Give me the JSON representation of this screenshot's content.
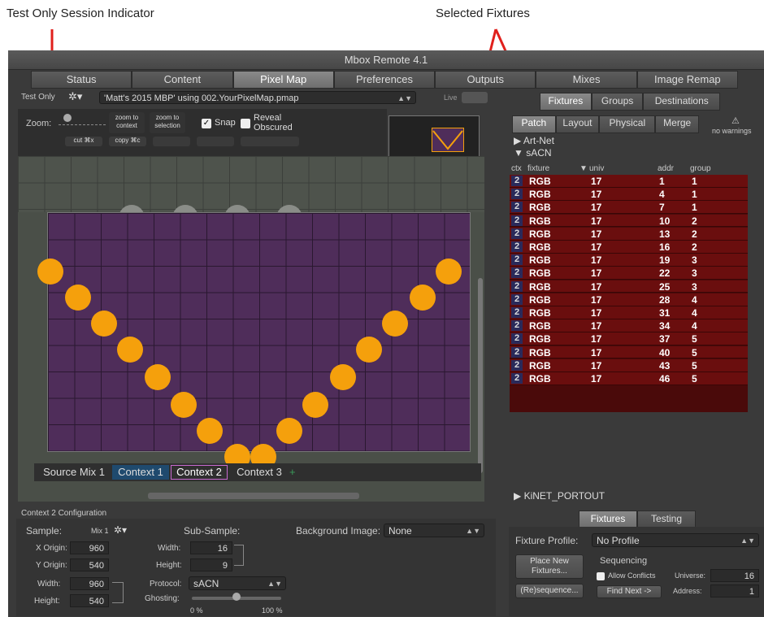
{
  "callouts": {
    "test_only": "Test Only Session Indicator",
    "selected": "Selected Fixtures"
  },
  "app": {
    "title": "Mbox Remote 4.1"
  },
  "tabs": [
    "Status",
    "Content",
    "Pixel Map",
    "Preferences",
    "Outputs",
    "Mixes",
    "Image Remap"
  ],
  "active_tab": "Pixel Map",
  "toolbar": {
    "test_only": "Test Only",
    "file": "'Matt's 2015 MBP' using 002.YourPixelMap.pmap",
    "live": "Live"
  },
  "canvas_tools": {
    "zoom_label": "Zoom:",
    "zoom_to_context": "zoom to context",
    "zoom_to_selection": "zoom to selection",
    "snap": "Snap",
    "reveal_obscured": "Reveal Obscured",
    "cut": "cut ⌘x",
    "copy": "copy ⌘c"
  },
  "right_tabs": [
    "Fixtures",
    "Groups",
    "Destinations"
  ],
  "sub_tabs": [
    "Patch",
    "Layout",
    "Physical",
    "Merge"
  ],
  "warnings": "no warnings",
  "tree": {
    "artnet": "Art-Net",
    "sacn": "sACN",
    "kinet": "KiNET_PORTOUT"
  },
  "table_headers": {
    "ctx": "ctx",
    "fixture": "fixture",
    "univ": "univ",
    "addr": "addr",
    "group": "group"
  },
  "fixtures": [
    {
      "ctx": "2",
      "fixture": "RGB",
      "univ": "17",
      "addr": "1",
      "group": "1"
    },
    {
      "ctx": "2",
      "fixture": "RGB",
      "univ": "17",
      "addr": "4",
      "group": "1"
    },
    {
      "ctx": "2",
      "fixture": "RGB",
      "univ": "17",
      "addr": "7",
      "group": "1"
    },
    {
      "ctx": "2",
      "fixture": "RGB",
      "univ": "17",
      "addr": "10",
      "group": "2"
    },
    {
      "ctx": "2",
      "fixture": "RGB",
      "univ": "17",
      "addr": "13",
      "group": "2"
    },
    {
      "ctx": "2",
      "fixture": "RGB",
      "univ": "17",
      "addr": "16",
      "group": "2"
    },
    {
      "ctx": "2",
      "fixture": "RGB",
      "univ": "17",
      "addr": "19",
      "group": "3"
    },
    {
      "ctx": "2",
      "fixture": "RGB",
      "univ": "17",
      "addr": "22",
      "group": "3"
    },
    {
      "ctx": "2",
      "fixture": "RGB",
      "univ": "17",
      "addr": "25",
      "group": "3"
    },
    {
      "ctx": "2",
      "fixture": "RGB",
      "univ": "17",
      "addr": "28",
      "group": "4"
    },
    {
      "ctx": "2",
      "fixture": "RGB",
      "univ": "17",
      "addr": "31",
      "group": "4"
    },
    {
      "ctx": "2",
      "fixture": "RGB",
      "univ": "17",
      "addr": "34",
      "group": "4"
    },
    {
      "ctx": "2",
      "fixture": "RGB",
      "univ": "17",
      "addr": "37",
      "group": "5"
    },
    {
      "ctx": "2",
      "fixture": "RGB",
      "univ": "17",
      "addr": "40",
      "group": "5"
    },
    {
      "ctx": "2",
      "fixture": "RGB",
      "univ": "17",
      "addr": "43",
      "group": "5"
    },
    {
      "ctx": "2",
      "fixture": "RGB",
      "univ": "17",
      "addr": "46",
      "group": "5"
    }
  ],
  "context_tabs": [
    "Source Mix 1",
    "Context 1",
    "Context 2",
    "Context 3",
    "+"
  ],
  "config": {
    "title": "Context 2 Configuration",
    "sample_label": "Sample:",
    "sample_value": "Mix 1",
    "x_origin_label": "X Origin:",
    "x_origin": "960",
    "y_origin_label": "Y Origin:",
    "y_origin": "540",
    "width_label": "Width:",
    "width": "960",
    "height_label": "Height:",
    "height": "540",
    "subsample_label": "Sub-Sample:",
    "sub_width_label": "Width:",
    "sub_width": "16",
    "sub_height_label": "Height:",
    "sub_height": "9",
    "protocol_label": "Protocol:",
    "protocol": "sACN",
    "ghosting_label": "Ghosting:",
    "ghost_min": "0 %",
    "ghost_max": "100 %",
    "bg_label": "Background Image:",
    "bg_value": "None"
  },
  "fixture_panel": {
    "tabs": [
      "Fixtures",
      "Testing"
    ],
    "profile_label": "Fixture Profile:",
    "profile_value": "No Profile",
    "place_new": "Place New Fixtures...",
    "sequencing": "Sequencing",
    "allow_conflicts": "Allow Conflicts",
    "universe_label": "Universe:",
    "universe": "16",
    "resequence": "(Re)sequence...",
    "find_next": "Find Next ->",
    "address_label": "Address:",
    "address": "1"
  }
}
